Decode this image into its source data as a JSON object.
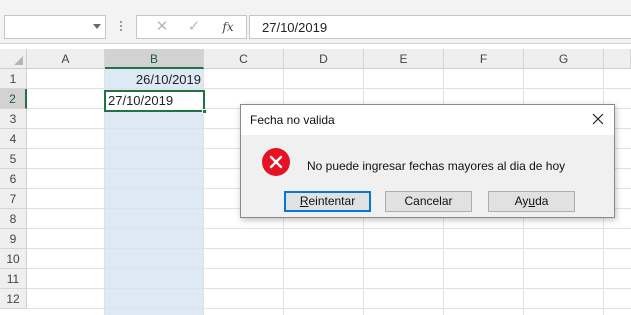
{
  "formula_bar": {
    "name_box": "",
    "cancel_icon": "✕",
    "enter_icon": "✓",
    "fx_label": "fx",
    "value": "27/10/2019"
  },
  "grid": {
    "columns": [
      "A",
      "B",
      "C",
      "D",
      "E",
      "F",
      "G"
    ],
    "rows": [
      "1",
      "2",
      "3",
      "4",
      "5",
      "6",
      "7",
      "8",
      "9",
      "10",
      "11",
      "12"
    ],
    "selected_column": "B",
    "selected_row": "2",
    "cells": {
      "B1": "26/10/2019",
      "B2": "27/10/2019"
    }
  },
  "dialog": {
    "title": "Fecha no valida",
    "message": "No puede ingresar fechas mayores al dia de hoy",
    "buttons": {
      "retry": {
        "before": "",
        "mnemonic": "R",
        "after": "eintentar"
      },
      "cancel": {
        "before": "Cancelar",
        "mnemonic": "",
        "after": ""
      },
      "help": {
        "before": "Ay",
        "mnemonic": "u",
        "after": "da"
      }
    }
  },
  "colors": {
    "accent_green": "#217346",
    "selection_fill": "#dde9f5",
    "error_red": "#e81123",
    "default_button_border": "#0078d7"
  },
  "icons": {
    "name_box_dropdown": "chevron-down-icon",
    "cancel": "cancel-icon",
    "enter": "check-icon",
    "function": "fx-icon",
    "dialog_close": "close-icon",
    "dialog_error": "error-icon"
  }
}
